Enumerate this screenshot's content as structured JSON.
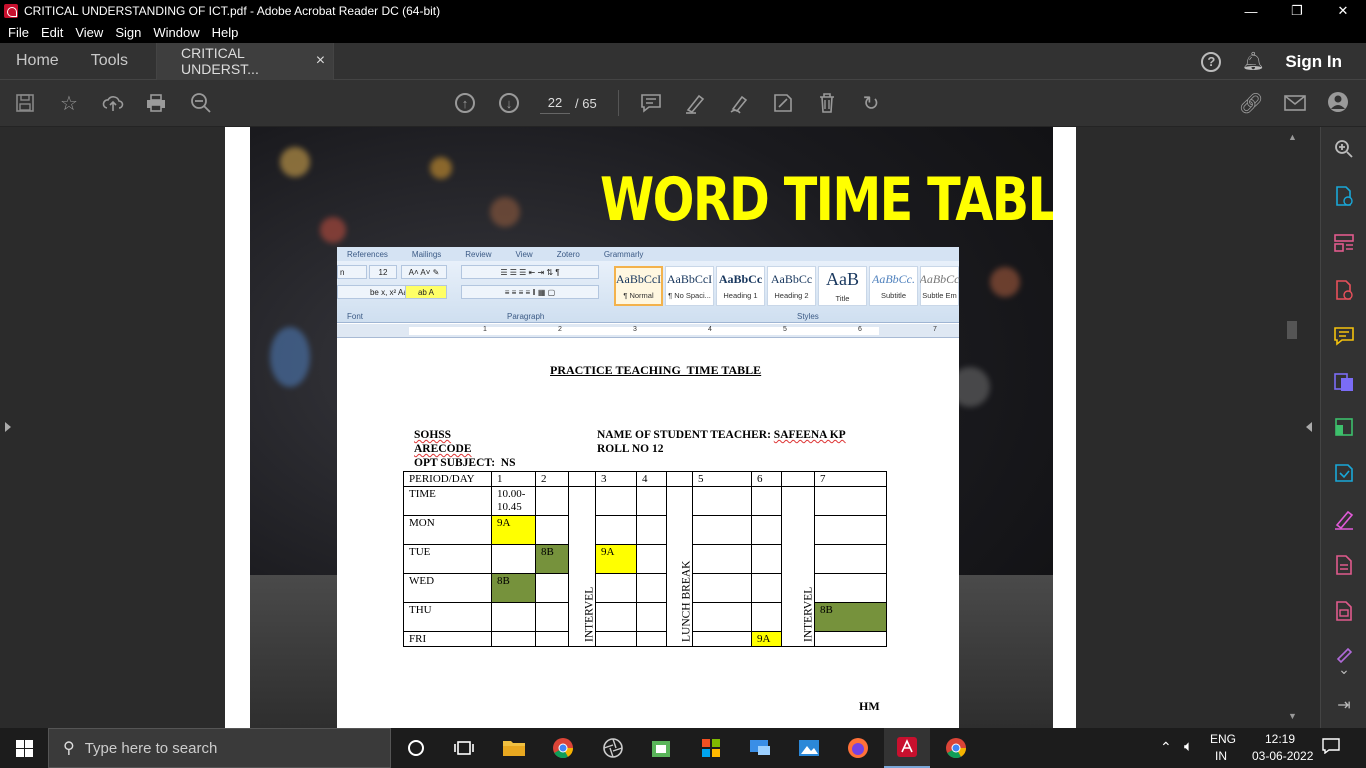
{
  "window": {
    "title": "CRITICAL UNDERSTANDING OF ICT.pdf - Adobe Acrobat Reader DC (64-bit)",
    "minimize": "—",
    "restore": "❐",
    "close": "✕"
  },
  "menu": [
    "File",
    "Edit",
    "View",
    "Sign",
    "Window",
    "Help"
  ],
  "tabs": {
    "home": "Home",
    "tools": "Tools",
    "doc": "CRITICAL UNDERST...",
    "doc_close": "×"
  },
  "header_right": {
    "sign_in": "Sign In"
  },
  "navigation": {
    "current_page": "22",
    "total_pages": "/  65"
  },
  "slide": {
    "title": "WORD TIME TABLE"
  },
  "word": {
    "ribbon_tabs": [
      "References",
      "Mailings",
      "Review",
      "View",
      "Zotero",
      "Grammarly"
    ],
    "font_name": "n",
    "font_size": "12",
    "group_labels": {
      "font": "Font",
      "paragraph": "Paragraph",
      "styles": "Styles"
    },
    "styles": [
      {
        "preview": "AaBbCcI",
        "name": "¶ Normal"
      },
      {
        "preview": "AaBbCcI",
        "name": "¶ No Spaci..."
      },
      {
        "preview": "AaBbCc",
        "name": "Heading 1"
      },
      {
        "preview": "AaBbCc",
        "name": "Heading 2"
      },
      {
        "preview": "AaB",
        "name": "Title"
      },
      {
        "preview": "AaBbCc.",
        "name": "Subtitle"
      },
      {
        "preview": "AaBbCc",
        "name": "Subtle Em"
      }
    ],
    "ruler_numbers": [
      "1",
      "2",
      "3",
      "4",
      "5",
      "6",
      "7"
    ]
  },
  "document": {
    "title": "PRACTICE TEACHING  TIME TABLE",
    "school": "SOHSS",
    "arecode": "ARECODE",
    "opt_subject": "OPT SUBJECT:  NS",
    "student_teacher_label": "NAME OF STUDENT TEACHER: ",
    "student_teacher_name": "SAFEENA KP",
    "roll_no": "ROLL NO 12",
    "hm": "HM",
    "table": {
      "header": [
        "PERIOD/DAY",
        "1",
        "2",
        "",
        "3",
        "4",
        "",
        "5",
        "6",
        "",
        "7"
      ],
      "time_row": [
        "TIME",
        "10.00-10.45"
      ],
      "days": [
        "MON",
        "TUE",
        "WED",
        "THU",
        "FRI"
      ],
      "cells": {
        "mon_p1": "9A",
        "tue_p2": "8B",
        "tue_p3": "9A",
        "wed_p1": "8B",
        "thu_p7": "8B",
        "fri_p6": "9A"
      },
      "breaks": {
        "interval1": "INTERVEL",
        "lunch": "LUNCH BREAK",
        "interval2": "INTERVEL"
      }
    }
  },
  "taskbar": {
    "search_placeholder": "Type here to search",
    "lang_top": "ENG",
    "lang_bottom": "IN",
    "time": "12:19",
    "date": "03-06-2022"
  }
}
